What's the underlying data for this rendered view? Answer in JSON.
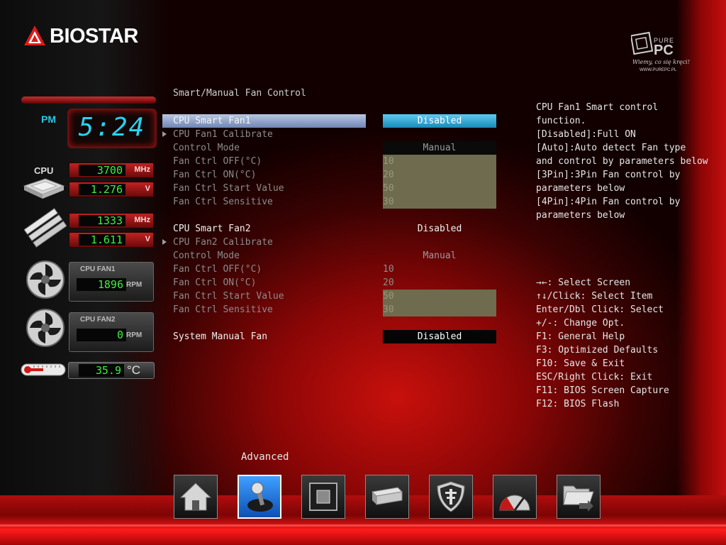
{
  "brand": {
    "name": "BIOSTAR"
  },
  "watermark": {
    "name": "PURE PC",
    "tagline": "Wiemy, co się kręci!",
    "url": "WWW.PUREPC.PL"
  },
  "clock": {
    "ampm": "PM",
    "time": "5:24"
  },
  "hardware": {
    "cpu_label": "CPU",
    "cpu_freq": "3700",
    "cpu_freq_unit": "MHz",
    "cpu_volt": "1.276",
    "cpu_volt_unit": "V",
    "mem_freq": "1333",
    "mem_freq_unit": "MHz",
    "mem_volt": "1.611",
    "mem_volt_unit": "V",
    "fan1_label": "CPU FAN1",
    "fan1_rpm": "1896",
    "fan1_unit": "RPM",
    "fan2_label": "CPU FAN2",
    "fan2_rpm": "0",
    "fan2_unit": "RPM",
    "temp": "35.9",
    "temp_unit": "°C"
  },
  "settings": {
    "section_title": "Smart/Manual Fan Control",
    "fan1": {
      "title": "CPU Smart Fan1",
      "value": "Disabled",
      "calibrate": "CPU Fan1 Calibrate",
      "mode_label": "Control Mode",
      "mode_value": "Manual",
      "off_label": "Fan Ctrl OFF(°C)",
      "off_value": "10",
      "on_label": "Fan Ctrl ON(°C)",
      "on_value": "20",
      "start_label": "Fan Ctrl Start Value",
      "start_value": "50",
      "sens_label": "Fan Ctrl Sensitive",
      "sens_value": "30"
    },
    "fan2": {
      "title": "CPU Smart Fan2",
      "value": "Disabled",
      "calibrate": "CPU Fan2 Calibrate",
      "mode_label": "Control Mode",
      "mode_value": "Manual",
      "off_label": "Fan Ctrl OFF(°C)",
      "off_value": "10",
      "on_label": "Fan Ctrl ON(°C)",
      "on_value": "20",
      "start_label": "Fan Ctrl Start Value",
      "start_value": "50",
      "sens_label": "Fan Ctrl Sensitive",
      "sens_value": "30"
    },
    "system": {
      "title": "System Manual Fan",
      "value": "Disabled"
    }
  },
  "help": {
    "description": [
      "CPU Fan1 Smart control",
      "function.",
      "[Disabled]:Full ON",
      "[Auto]:Auto detect Fan type",
      "and control by parameters below",
      "[3Pin]:3Pin Fan control by",
      "parameters below",
      "[4Pin]:4Pin Fan control by",
      "parameters below"
    ],
    "keys": [
      "→←: Select Screen",
      "↑↓/Click: Select Item",
      "Enter/Dbl Click: Select",
      "+/-: Change Opt.",
      "F1: General Help",
      "F3: Optimized Defaults",
      "F10: Save & Exit",
      "ESC/Right Click: Exit",
      "F11: BIOS Screen Capture",
      "F12: BIOS Flash"
    ]
  },
  "tabs": {
    "active_label": "Advanced",
    "icons": [
      "home-icon",
      "advanced-joystick-icon",
      "chipset-icon",
      "boot-drive-icon",
      "security-shield-icon",
      "o-n-e-gauge-icon",
      "save-exit-folder-icon"
    ]
  }
}
